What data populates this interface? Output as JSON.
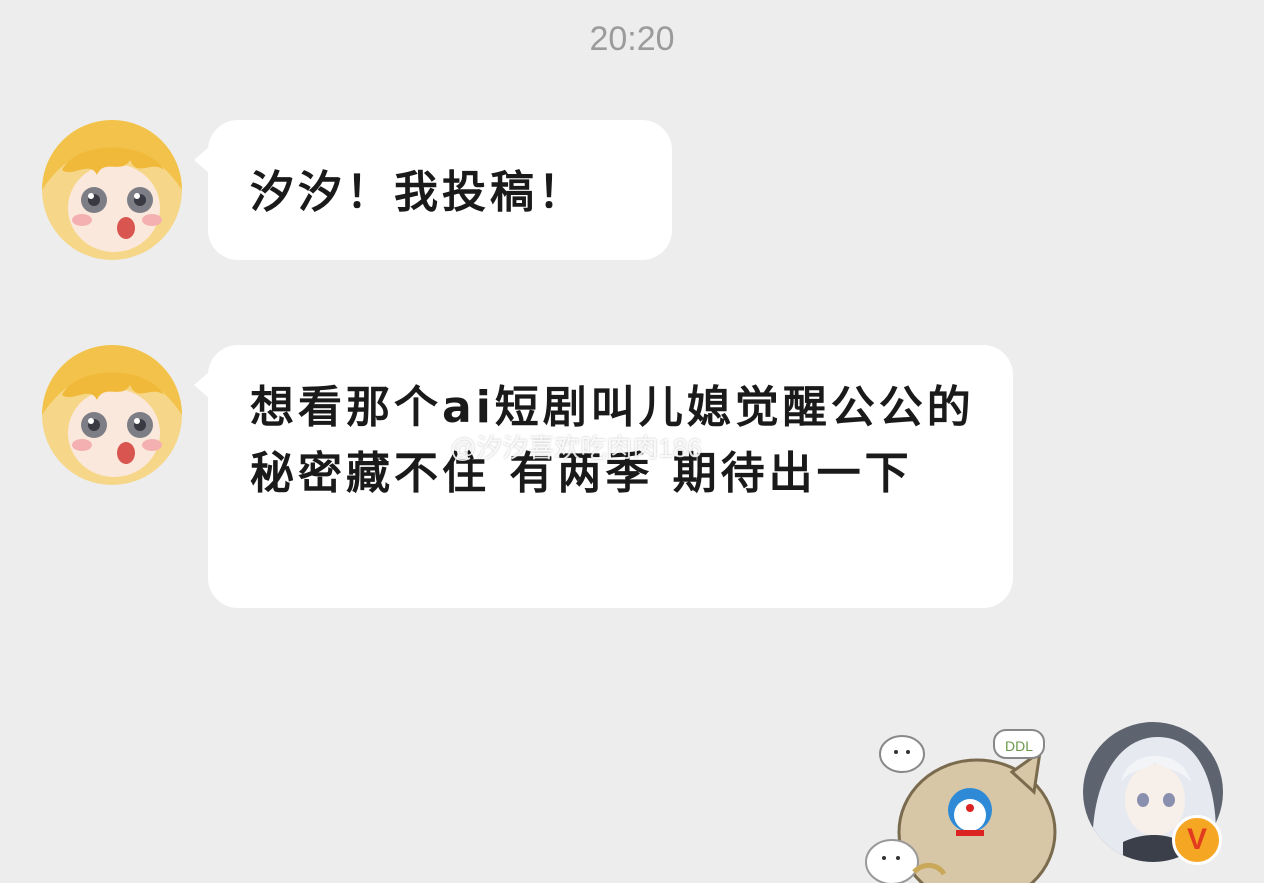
{
  "chat": {
    "timestamp": "20:20",
    "messages": [
      {
        "sender": "other",
        "text": "汐汐！我投稿！"
      },
      {
        "sender": "other",
        "text": "想看那个ai短剧叫儿媳觉醒公公的秘密藏不住 有两季 期待出一下"
      }
    ],
    "watermark": "@汐汐喜欢吃肉肉186",
    "sticker": {
      "caption": "DDL"
    },
    "self_badge": "V"
  },
  "colors": {
    "background": "#ededed",
    "bubble": "#ffffff",
    "timestamp": "#9b9b9b",
    "badge": "#f5a623"
  }
}
